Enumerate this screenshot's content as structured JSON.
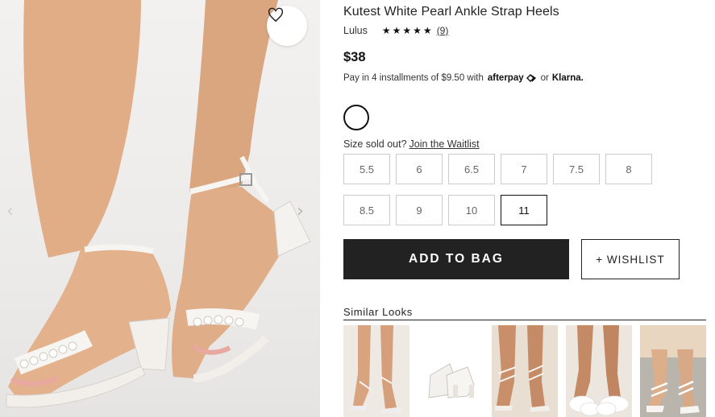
{
  "product": {
    "title": "Kutest White Pearl Ankle Strap Heels",
    "brand": "Lulus",
    "stars": "★★★★★",
    "review_count": "(9)",
    "price": "$38",
    "installment_text": "Pay in 4 installments of $9.50 with",
    "afterpay": "afterpay",
    "or": "or",
    "klarna": "Klarna."
  },
  "color_swatch": {
    "color": "#ffffff"
  },
  "sizes": {
    "soldout_text": "Size sold out?",
    "waitlist_link": "Join the Waitlist",
    "items": [
      "5.5",
      "6",
      "6.5",
      "7",
      "7.5",
      "8",
      "8.5",
      "9",
      "10",
      "11"
    ],
    "selected": "11"
  },
  "actions": {
    "add_to_bag": "ADD TO BAG",
    "wishlist": "+ WISHLIST"
  },
  "similar": {
    "title": "Similar Looks",
    "count": 5
  },
  "icons": {
    "heart": "heart-icon",
    "prev": "chevron-left-icon",
    "next": "chevron-right-icon",
    "afterpay": "afterpay-loop-icon"
  }
}
